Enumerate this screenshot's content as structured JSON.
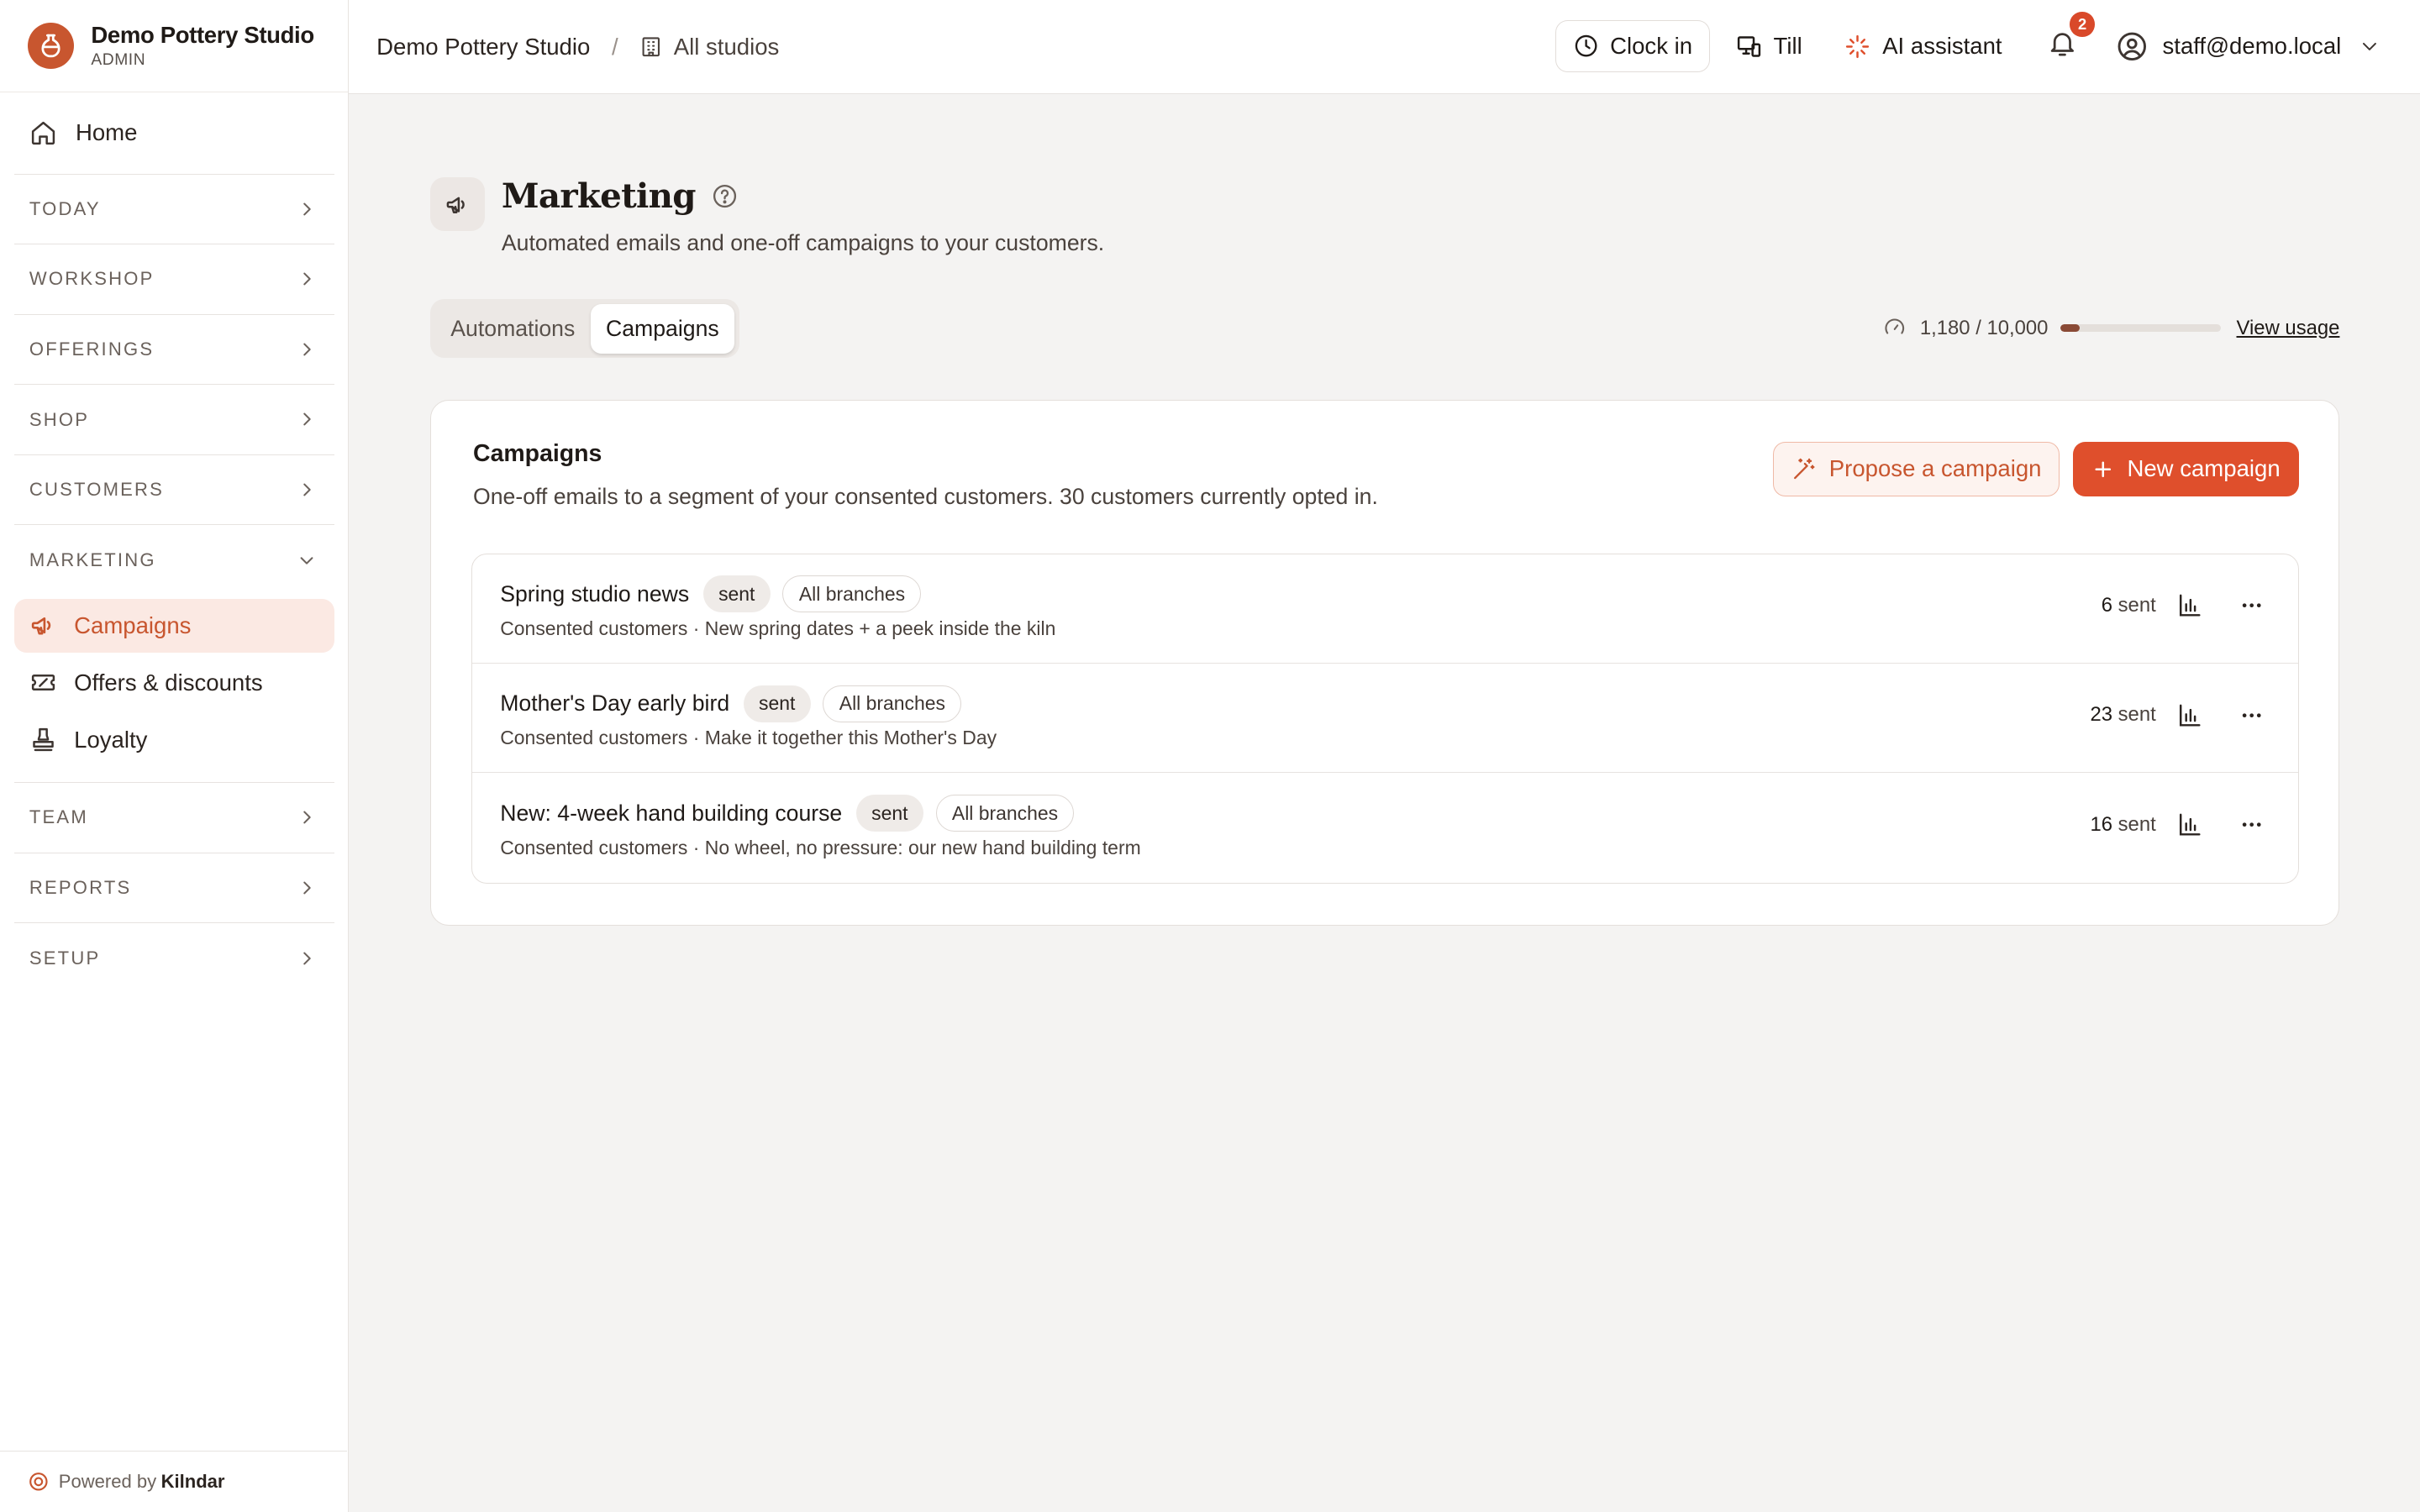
{
  "brand": {
    "name": "Demo Pottery Studio",
    "role": "ADMIN"
  },
  "sidebar": {
    "home": "Home",
    "sections": [
      "TODAY",
      "WORKSHOP",
      "OFFERINGS",
      "SHOP",
      "CUSTOMERS"
    ],
    "marketing": {
      "label": "MARKETING",
      "items": [
        {
          "label": "Campaigns",
          "icon": "megaphone-icon",
          "active": true
        },
        {
          "label": "Offers & discounts",
          "icon": "ticket-icon",
          "active": false
        },
        {
          "label": "Loyalty",
          "icon": "stamp-icon",
          "active": false
        }
      ]
    },
    "sections_after": [
      "TEAM",
      "REPORTS",
      "SETUP"
    ],
    "footer": {
      "prefix": "Powered by",
      "brand": "Kilndar"
    }
  },
  "topbar": {
    "breadcrumb": "Demo Pottery Studio",
    "separator": "/",
    "studios": "All studios",
    "clock_in": "Clock in",
    "till": "Till",
    "ai_assistant": "AI assistant",
    "notifications": "2",
    "user": "staff@demo.local"
  },
  "page": {
    "title": "Marketing",
    "subtitle": "Automated emails and one-off campaigns to your customers.",
    "tabs": [
      {
        "label": "Automations",
        "active": false
      },
      {
        "label": "Campaigns",
        "active": true
      }
    ],
    "usage": {
      "text": "1,180 / 10,000",
      "used": 1180,
      "limit": 10000,
      "link": "View usage"
    }
  },
  "campaigns": {
    "title": "Campaigns",
    "subtitle": "One-off emails to a segment of your consented customers. 30 customers currently opted in.",
    "propose_label": "Propose a campaign",
    "new_label": "New campaign",
    "rows": [
      {
        "name": "Spring studio news",
        "status": "sent",
        "branch": "All branches",
        "audience": "Consented customers",
        "separator": "·",
        "subject": "New spring dates + a peek inside the kiln",
        "count": "6",
        "count_label": "sent"
      },
      {
        "name": "Mother's Day early bird",
        "status": "sent",
        "branch": "All branches",
        "audience": "Consented customers",
        "separator": "·",
        "subject": "Make it together this Mother's Day",
        "count": "23",
        "count_label": "sent"
      },
      {
        "name": "New: 4-week hand building course",
        "status": "sent",
        "branch": "All branches",
        "audience": "Consented customers",
        "separator": "·",
        "subject": "No wheel, no pressure: our new hand building term",
        "count": "16",
        "count_label": "sent"
      }
    ]
  },
  "colors": {
    "accent": "#df4f2c",
    "accent_soft": "#fbe9e3",
    "brand_logo": "#c8562f"
  }
}
